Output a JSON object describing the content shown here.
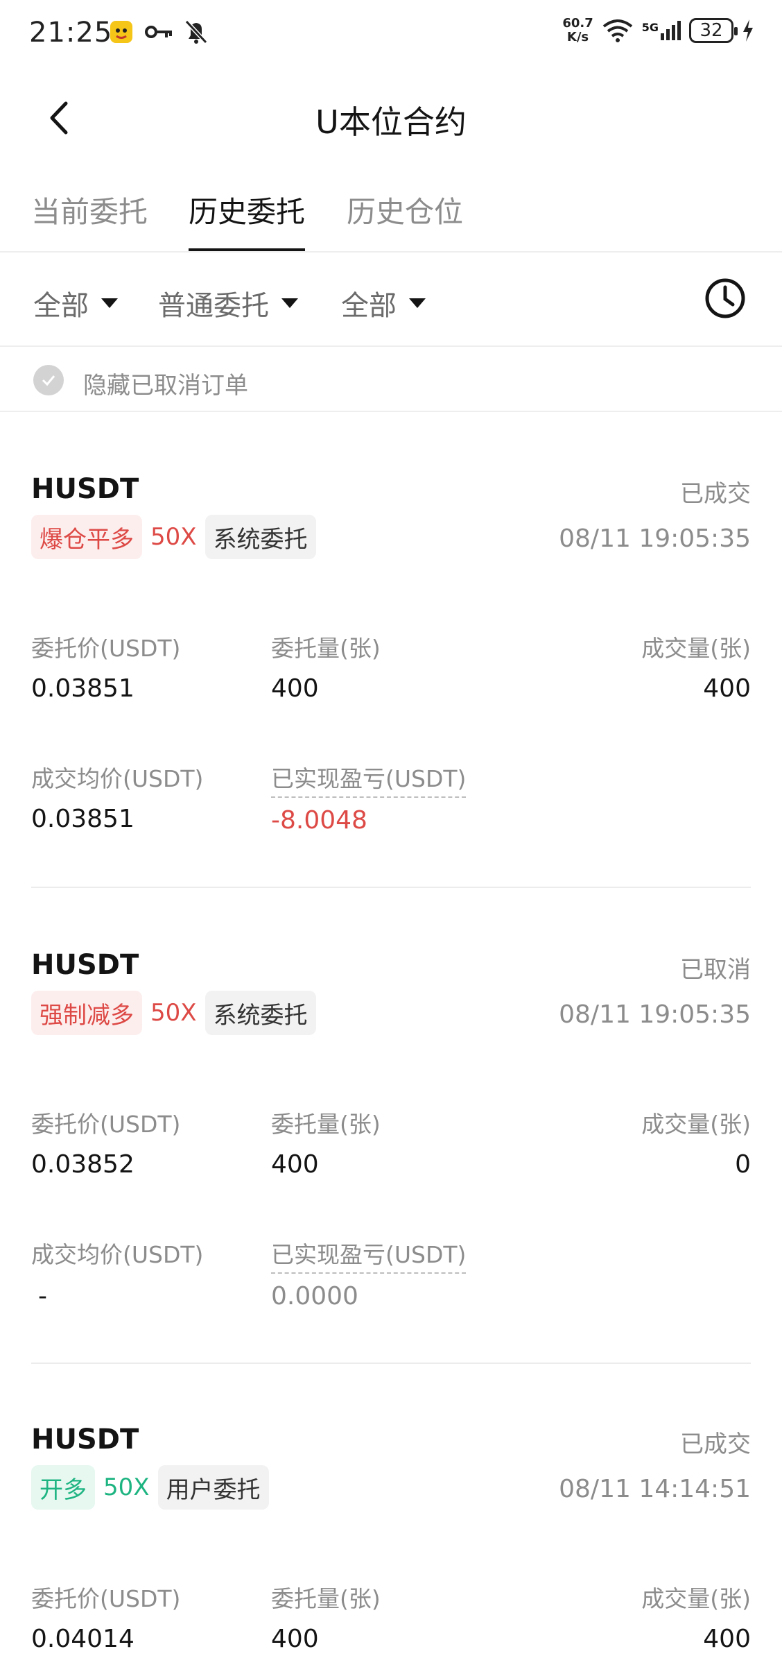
{
  "status_bar": {
    "time": "21:25",
    "speed_top": "60.7",
    "speed_bottom": "K/s",
    "network": "5G",
    "battery": "32"
  },
  "header": {
    "title": "U本位合约"
  },
  "tabs": [
    {
      "label": "当前委托",
      "active": false
    },
    {
      "label": "历史委托",
      "active": true
    },
    {
      "label": "历史仓位",
      "active": false
    }
  ],
  "filters": {
    "filter1": "全部",
    "filter2": "普通委托",
    "filter3": "全部"
  },
  "hide_cancelled": "隐藏已取消订单",
  "labels": {
    "order_price": "委托价(USDT)",
    "order_qty": "委托量(张)",
    "filled_qty": "成交量(张)",
    "avg_price": "成交均价(USDT)",
    "realized_pnl": "已实现盈亏(USDT)"
  },
  "orders": [
    {
      "symbol": "HUSDT",
      "status": "已成交",
      "side": "爆仓平多",
      "leverage": "50X",
      "source": "系统委托",
      "time": "08/11 19:05:35",
      "order_price": "0.03851",
      "order_qty": "400",
      "filled_qty": "400",
      "avg_price": "0.03851",
      "realized_pnl": "-8.0048"
    },
    {
      "symbol": "HUSDT",
      "status": "已取消",
      "side": "强制减多",
      "leverage": "50X",
      "source": "系统委托",
      "time": "08/11 19:05:35",
      "order_price": "0.03852",
      "order_qty": "400",
      "filled_qty": "0",
      "avg_price": "-",
      "realized_pnl": "0.0000"
    },
    {
      "symbol": "HUSDT",
      "status": "已成交",
      "side": "开多",
      "leverage": "50X",
      "source": "用户委托",
      "time": "08/11 14:14:51",
      "order_price": "0.04014",
      "order_qty": "400",
      "filled_qty": "400"
    }
  ],
  "colors": {
    "red": "#dd4a46",
    "green": "#1eb482",
    "muted": "#8c8c8c"
  }
}
